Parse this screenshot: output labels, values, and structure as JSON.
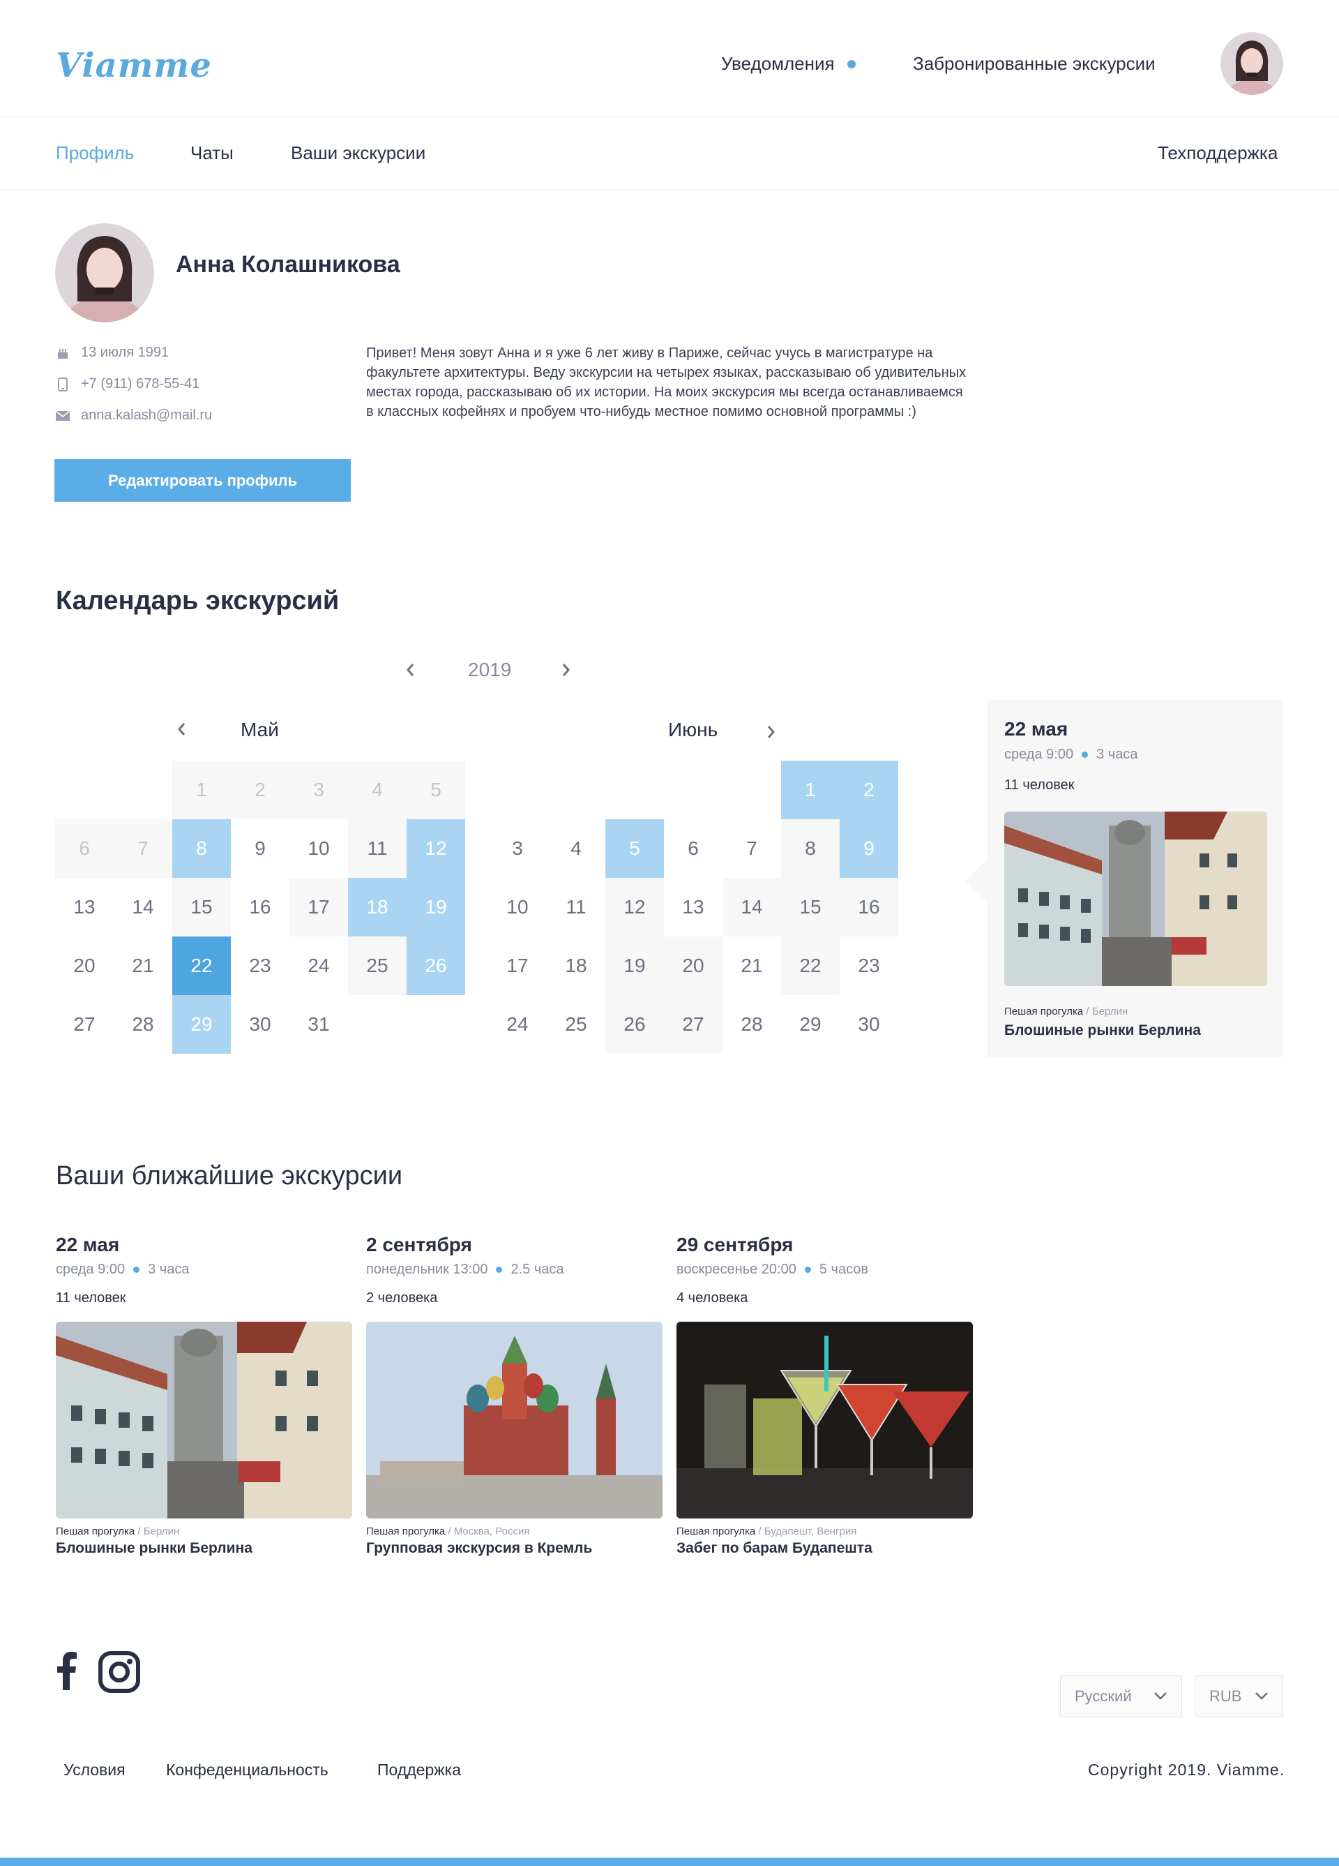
{
  "brand": {
    "logo": "Viamme",
    "accent": "#5aa9df",
    "dark_accent": "#4ea6e1",
    "light_accent": "#a9d5f2"
  },
  "header": {
    "notifications_label": "Уведомления",
    "booked_label": "Забронированные экскурсии",
    "avatar_icon": "user-avatar"
  },
  "tabs": {
    "profile": "Профиль",
    "chats": "Чаты",
    "excursions": "Ваши экскурсии",
    "support": "Техподдержка"
  },
  "profile": {
    "name": "Анна Колашникова",
    "birthday": "13 июля 1991",
    "phone": "+7 (911) 678-55-41",
    "email": "anna.kalash@mail.ru",
    "bio": "Привет! Меня зовут Анна и я уже 6 лет живу в Париже, сейчас учусь в магистратуре  на факультете  архитектуры. Веду экскурсии на четырех языках, рассказываю об удивительных местах города, рассказываю об их истории. На моих экскурсия мы всегда останавливаемся в классных кофейнях и пробуем что-нибудь местное помимо основной программы :)",
    "edit_button": "Редактировать профиль"
  },
  "calendar": {
    "title": "Календарь экскурсий",
    "year": "2019",
    "may": {
      "label": "Май",
      "weeks": [
        [
          {
            "d": "",
            "s": "empty"
          },
          {
            "d": "",
            "s": "empty"
          },
          {
            "d": "1",
            "s": "muted-gray"
          },
          {
            "d": "2",
            "s": "muted-gray"
          },
          {
            "d": "3",
            "s": "muted-gray"
          },
          {
            "d": "4",
            "s": "muted-gray"
          },
          {
            "d": "5",
            "s": "muted-gray"
          }
        ],
        [
          {
            "d": "6",
            "s": "muted-gray"
          },
          {
            "d": "7",
            "s": "muted-gray"
          },
          {
            "d": "8",
            "s": "light"
          },
          {
            "d": "9",
            "s": "plain"
          },
          {
            "d": "10",
            "s": "plain"
          },
          {
            "d": "11",
            "s": "gray"
          },
          {
            "d": "12",
            "s": "light"
          }
        ],
        [
          {
            "d": "13",
            "s": "plain"
          },
          {
            "d": "14",
            "s": "plain"
          },
          {
            "d": "15",
            "s": "gray"
          },
          {
            "d": "16",
            "s": "plain"
          },
          {
            "d": "17",
            "s": "gray"
          },
          {
            "d": "18",
            "s": "light"
          },
          {
            "d": "19",
            "s": "light"
          }
        ],
        [
          {
            "d": "20",
            "s": "plain"
          },
          {
            "d": "21",
            "s": "plain"
          },
          {
            "d": "22",
            "s": "dark"
          },
          {
            "d": "23",
            "s": "plain"
          },
          {
            "d": "24",
            "s": "plain"
          },
          {
            "d": "25",
            "s": "gray"
          },
          {
            "d": "26",
            "s": "light"
          }
        ],
        [
          {
            "d": "27",
            "s": "plain"
          },
          {
            "d": "28",
            "s": "plain"
          },
          {
            "d": "29",
            "s": "light"
          },
          {
            "d": "30",
            "s": "plain"
          },
          {
            "d": "31",
            "s": "plain"
          },
          {
            "d": "",
            "s": "empty"
          },
          {
            "d": "",
            "s": "empty"
          }
        ]
      ]
    },
    "june": {
      "label": "Июнь",
      "weeks": [
        [
          {
            "d": "",
            "s": "empty"
          },
          {
            "d": "",
            "s": "empty"
          },
          {
            "d": "",
            "s": "empty"
          },
          {
            "d": "",
            "s": "empty"
          },
          {
            "d": "",
            "s": "empty"
          },
          {
            "d": "1",
            "s": "light"
          },
          {
            "d": "2",
            "s": "light"
          }
        ],
        [
          {
            "d": "3",
            "s": "plain"
          },
          {
            "d": "4",
            "s": "plain"
          },
          {
            "d": "5",
            "s": "light"
          },
          {
            "d": "6",
            "s": "plain"
          },
          {
            "d": "7",
            "s": "plain"
          },
          {
            "d": "8",
            "s": "gray"
          },
          {
            "d": "9",
            "s": "light"
          }
        ],
        [
          {
            "d": "10",
            "s": "plain"
          },
          {
            "d": "11",
            "s": "plain"
          },
          {
            "d": "12",
            "s": "gray"
          },
          {
            "d": "13",
            "s": "plain"
          },
          {
            "d": "14",
            "s": "gray"
          },
          {
            "d": "15",
            "s": "gray"
          },
          {
            "d": "16",
            "s": "gray"
          }
        ],
        [
          {
            "d": "17",
            "s": "plain"
          },
          {
            "d": "18",
            "s": "plain"
          },
          {
            "d": "19",
            "s": "gray"
          },
          {
            "d": "20",
            "s": "gray"
          },
          {
            "d": "21",
            "s": "plain"
          },
          {
            "d": "22",
            "s": "gray"
          },
          {
            "d": "23",
            "s": "plain"
          }
        ],
        [
          {
            "d": "24",
            "s": "plain"
          },
          {
            "d": "25",
            "s": "plain"
          },
          {
            "d": "26",
            "s": "gray"
          },
          {
            "d": "27",
            "s": "gray"
          },
          {
            "d": "28",
            "s": "plain"
          },
          {
            "d": "29",
            "s": "plain"
          },
          {
            "d": "30",
            "s": "plain"
          }
        ]
      ]
    },
    "selected": {
      "date": "22 мая",
      "time": "среда 9:00",
      "duration": "3 часа",
      "people": "11 человек",
      "type": "Пешая прогулка",
      "location": "/ Берлин",
      "title": "Блошиные рынки Берлина"
    }
  },
  "upcoming": {
    "title": "Ваши ближайшие экскурсии",
    "items": [
      {
        "date": "22 мая",
        "time": "среда 9:00",
        "duration": "3 часа",
        "people": "11 человек",
        "type": "Пешая прогулка",
        "location": "/ Берлин",
        "title": "Блошиные рынки Берлина"
      },
      {
        "date": "2 сентября",
        "time": "понедельник 13:00",
        "duration": "2.5 часа",
        "people": "2 человека",
        "type": "Пешая прогулка",
        "location": "/ Москва, Россия",
        "title": "Групповая экскурсия в Кремль"
      },
      {
        "date": "29 сентября",
        "time": "воскресенье 20:00",
        "duration": "5 часов",
        "people": "4 человека",
        "type": "Пешая прогулка",
        "location": "/ Будапешт, Венгрия",
        "title": "Забег по барам Будапешта"
      }
    ]
  },
  "footer": {
    "language": "Русский",
    "currency": "RUB",
    "links": [
      "Условия",
      "Конфеденциальность",
      "Поддержка"
    ],
    "copyright": "Copyright 2019. Viamme.",
    "social_icons": [
      "facebook-icon",
      "instagram-icon"
    ]
  }
}
